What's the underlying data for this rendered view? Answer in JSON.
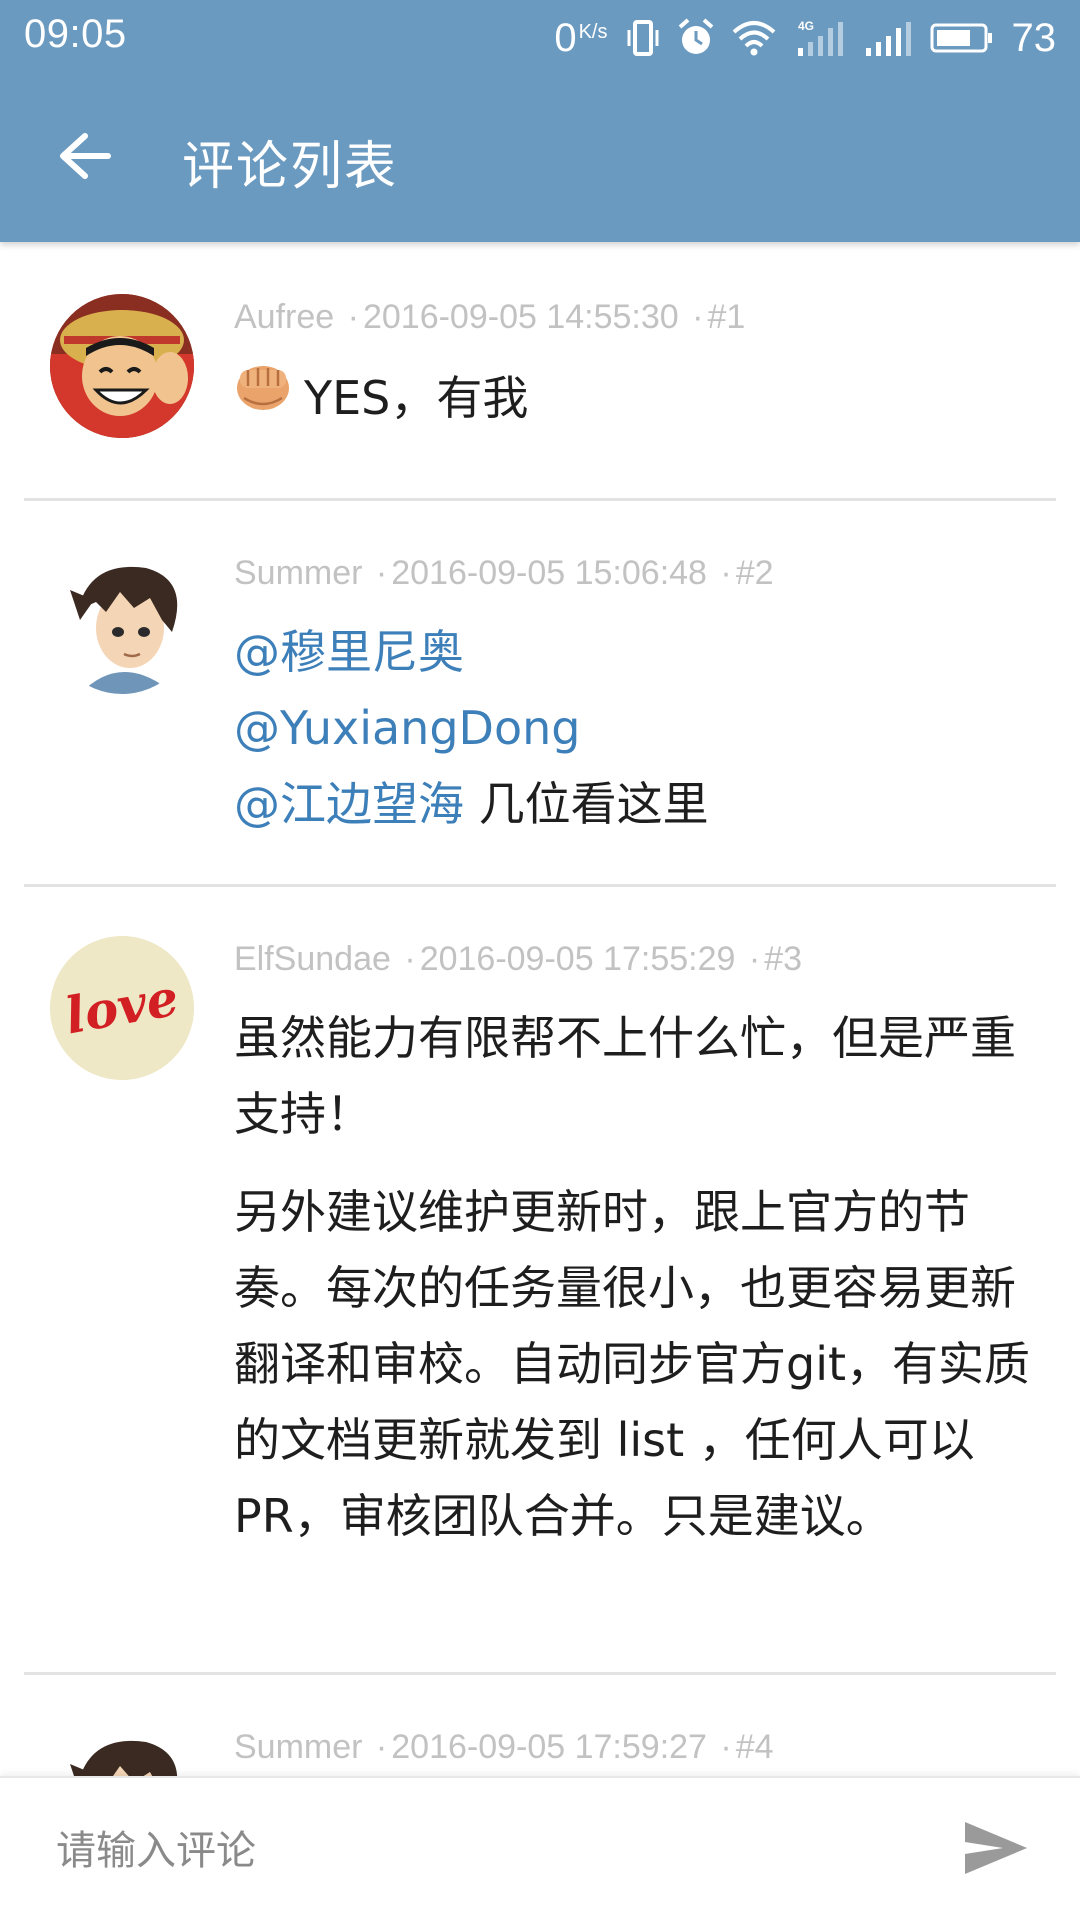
{
  "status_bar": {
    "time": "09:05",
    "net_speed": "0",
    "net_speed_unit": "K/s",
    "battery_level": "73",
    "icons": [
      "vibrate-icon",
      "alarm-icon",
      "wifi-icon",
      "signal-4g-icon",
      "signal-icon",
      "battery-icon"
    ]
  },
  "toolbar": {
    "title": "评论列表",
    "back_icon": "arrow-left-icon"
  },
  "comments": [
    {
      "author": "Aufree",
      "time": "2016-09-05 14:55:30",
      "floor": "#1",
      "emoji": "fist-icon",
      "text": "YES，有我"
    },
    {
      "author": "Summer",
      "time": "2016-09-05 15:06:48",
      "floor": "#2",
      "mentions": [
        "@穆里尼奥",
        "@YuxiangDong",
        "@江边望海"
      ],
      "text_after": "几位看这里"
    },
    {
      "author": "ElfSundae",
      "time": "2016-09-05 17:55:29",
      "floor": "#3",
      "avatar_text": "love",
      "paragraphs": [
        "虽然能力有限帮不上什么忙，但是严重支持！",
        "另外建议维护更新时，跟上官方的节奏。每次的任务量很小，也更容易更新翻译和审校。自动同步官方git，有实质的文档更新就发到 list ，任何人可以 PR，审核团队合并。只是建议。"
      ]
    },
    {
      "author": "Summer",
      "time": "2016-09-05 17:59:27",
      "floor": "#4"
    }
  ],
  "meta_separator": "·",
  "input_bar": {
    "placeholder": "请输入评论",
    "send_icon": "send-icon"
  },
  "colors": {
    "header": "#6b9ac0",
    "mention": "#3d7fb9",
    "meta_text": "#c2c2c2"
  }
}
